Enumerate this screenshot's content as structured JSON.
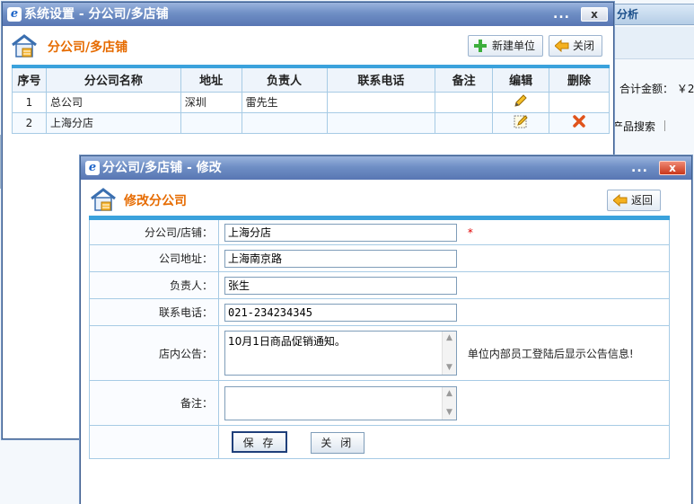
{
  "background": {
    "tab_label": "分析",
    "total_label": "合计金额： ￥2",
    "search_label": "产品搜索"
  },
  "list_window": {
    "title": "系统设置 - 分公司/多店铺",
    "title_dots": "...",
    "close_label": "x",
    "panel_title": "分公司/多店铺",
    "add_button": "新建单位",
    "close_button": "关闭",
    "columns": [
      "序号",
      "分公司名称",
      "地址",
      "负责人",
      "联系电话",
      "备注",
      "编辑",
      "删除"
    ],
    "rows": [
      {
        "no": "1",
        "name": "总公司",
        "address": "深圳",
        "manager": "雷先生",
        "phone": "",
        "note": ""
      },
      {
        "no": "2",
        "name": "上海分店",
        "address": "",
        "manager": "",
        "phone": "",
        "note": ""
      }
    ]
  },
  "edit_window": {
    "title": "分公司/多店铺 - 修改",
    "title_dots": "...",
    "close_label": "x",
    "panel_title": "修改分公司",
    "back_button": "返回",
    "fields": {
      "branch_label": "分公司/店铺：",
      "branch_value": "上海分店",
      "required_mark": "*",
      "address_label": "公司地址：",
      "address_value": "上海南京路",
      "manager_label": "负责人：",
      "manager_value": "张生",
      "phone_label": "联系电话：",
      "phone_value": "021-234234345",
      "notice_label": "店内公告：",
      "notice_value": "10月1日商品促销通知。",
      "notice_hint": "单位内部员工登陆后显示公告信息!",
      "remark_label": "备注：",
      "remark_value": ""
    },
    "save_button": "保 存",
    "cancel_button": "关 闭"
  },
  "colors": {
    "accent_orange": "#e66b00",
    "table_top_border": "#3ba2dc",
    "titlebar_blue": "#6f8fc5"
  }
}
